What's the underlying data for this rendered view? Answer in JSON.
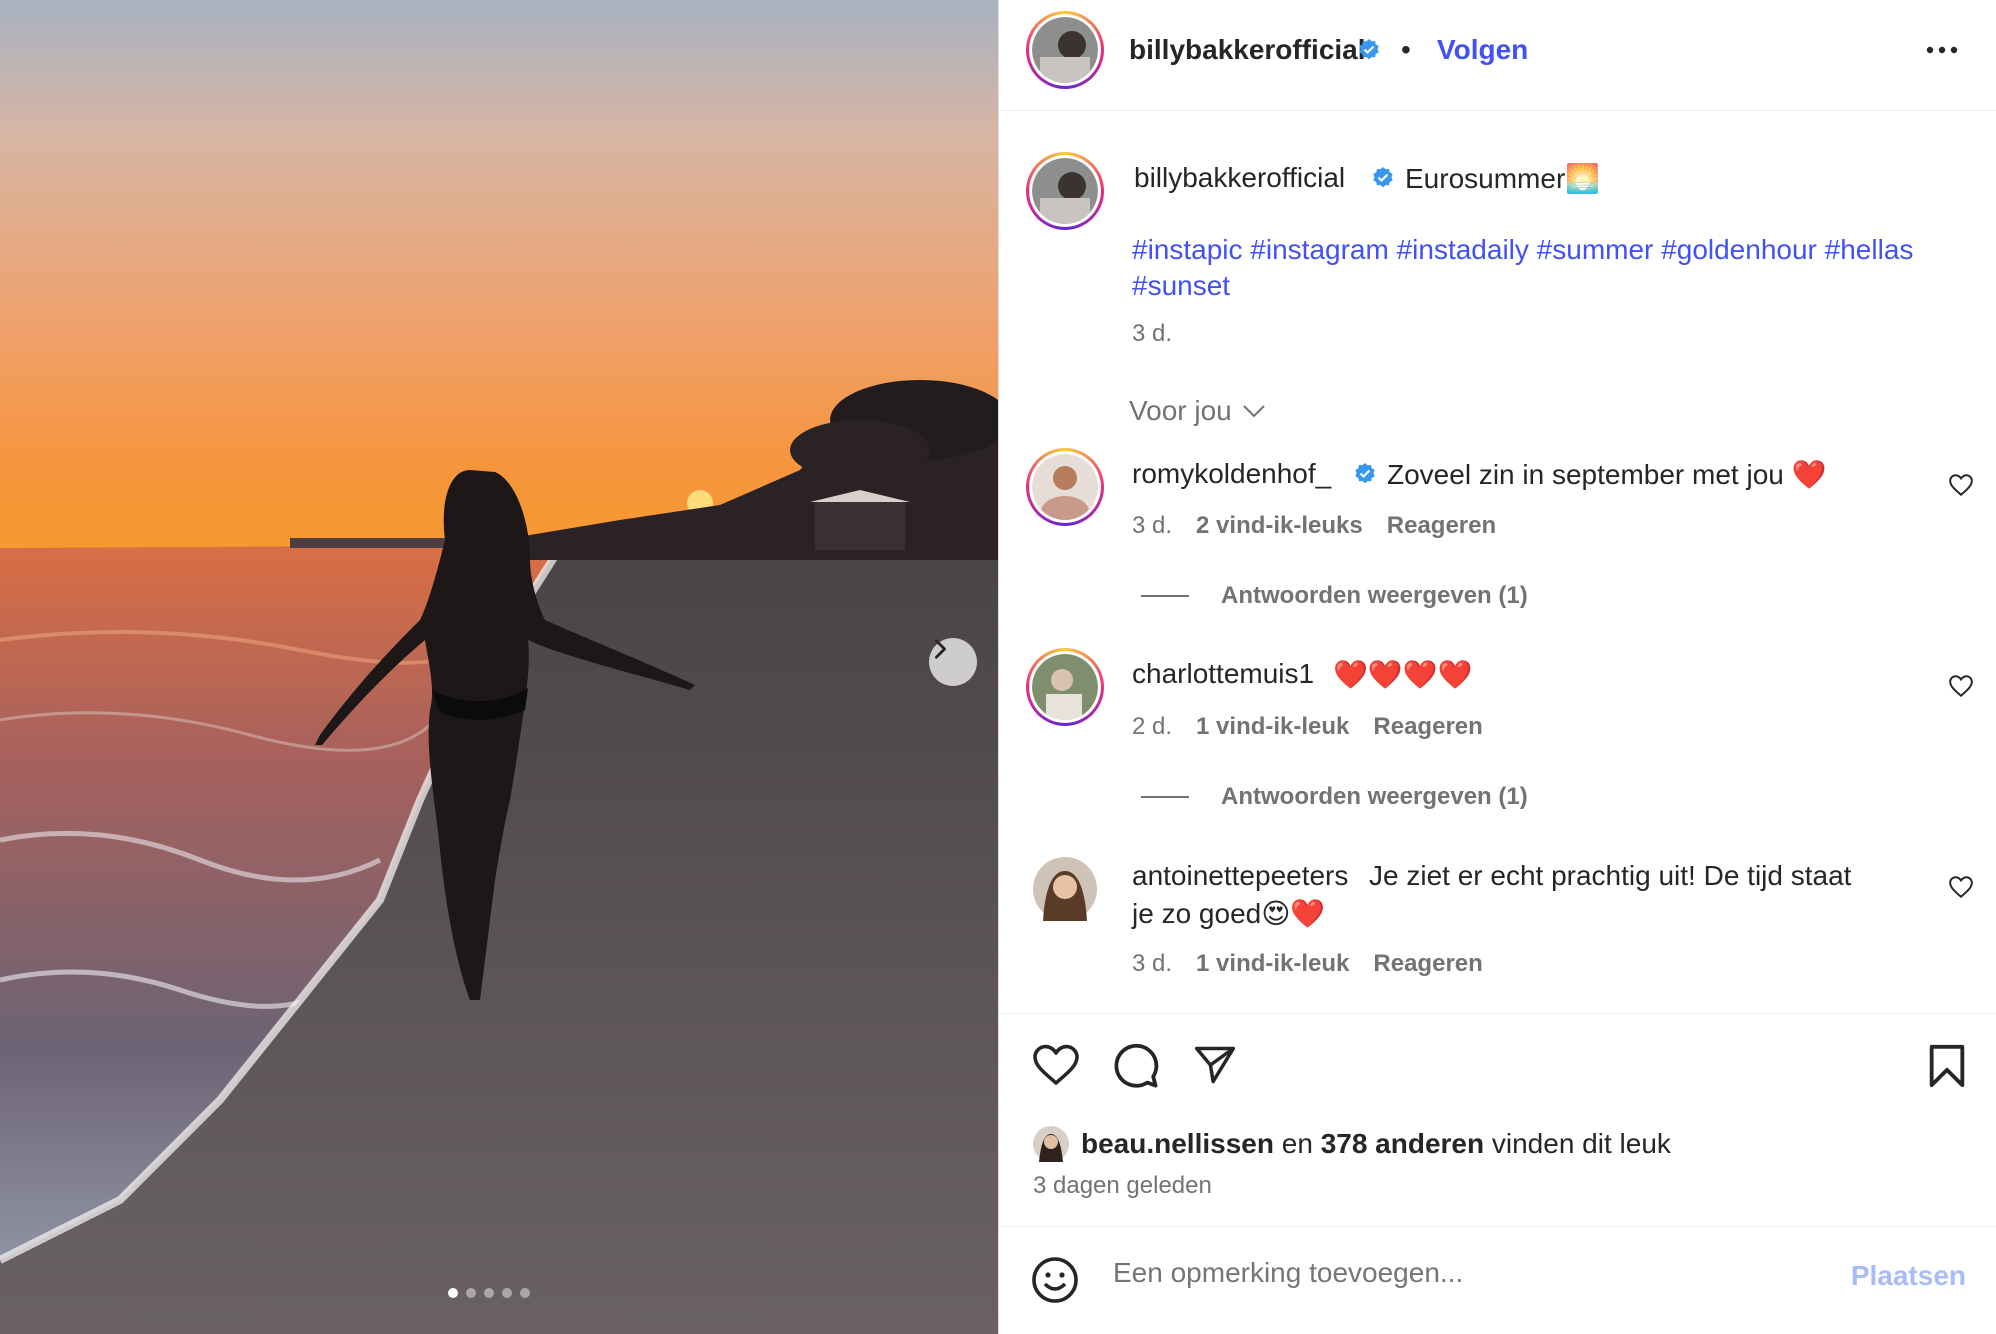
{
  "header": {
    "username": "billybakkerofficial",
    "separator": "•",
    "follow_label": "Volgen"
  },
  "caption": {
    "username": "billybakkerofficial",
    "text": "Eurosummer🌅",
    "hashtags_line1": [
      "#instapic",
      "#instagram",
      "#instadaily",
      "#summer",
      "#goldenhour",
      "#hellas"
    ],
    "hashtags_line2": [
      "#sunset"
    ],
    "time": "3 d."
  },
  "sort": {
    "label": "Voor jou"
  },
  "comments": [
    {
      "username": "romykoldenhof_",
      "verified": true,
      "text": "Zoveel zin in september met jou ❤️",
      "time": "3 d.",
      "likes": "2 vind-ik-leuks",
      "reply": "Reageren",
      "replies": "Antwoorden weergeven (1)"
    },
    {
      "username": "charlottemuis1",
      "verified": false,
      "text": "❤️❤️❤️❤️",
      "time": "2 d.",
      "likes": "1 vind-ik-leuk",
      "reply": "Reageren",
      "replies": "Antwoorden weergeven (1)"
    },
    {
      "username": "antoinettepeeters",
      "verified": false,
      "text": "Je ziet er echt prachtig uit! De tijd staat",
      "text2": "je zo goed😍❤️",
      "time": "3 d.",
      "likes": "1 vind-ik-leuk",
      "reply": "Reageren"
    }
  ],
  "likes": {
    "first_user": "beau.nellissen",
    "connector": "en",
    "others": "378 anderen",
    "suffix": "vinden dit leuk"
  },
  "post_time": "3 dagen geleden",
  "comment_box": {
    "placeholder": "Een opmerking toevoegen...",
    "post_label": "Plaatsen"
  },
  "carousel": {
    "count": 5,
    "active": 0
  },
  "colors": {
    "link": "#4150f7",
    "verified": "#3897f0",
    "heart": "#ed4956"
  }
}
